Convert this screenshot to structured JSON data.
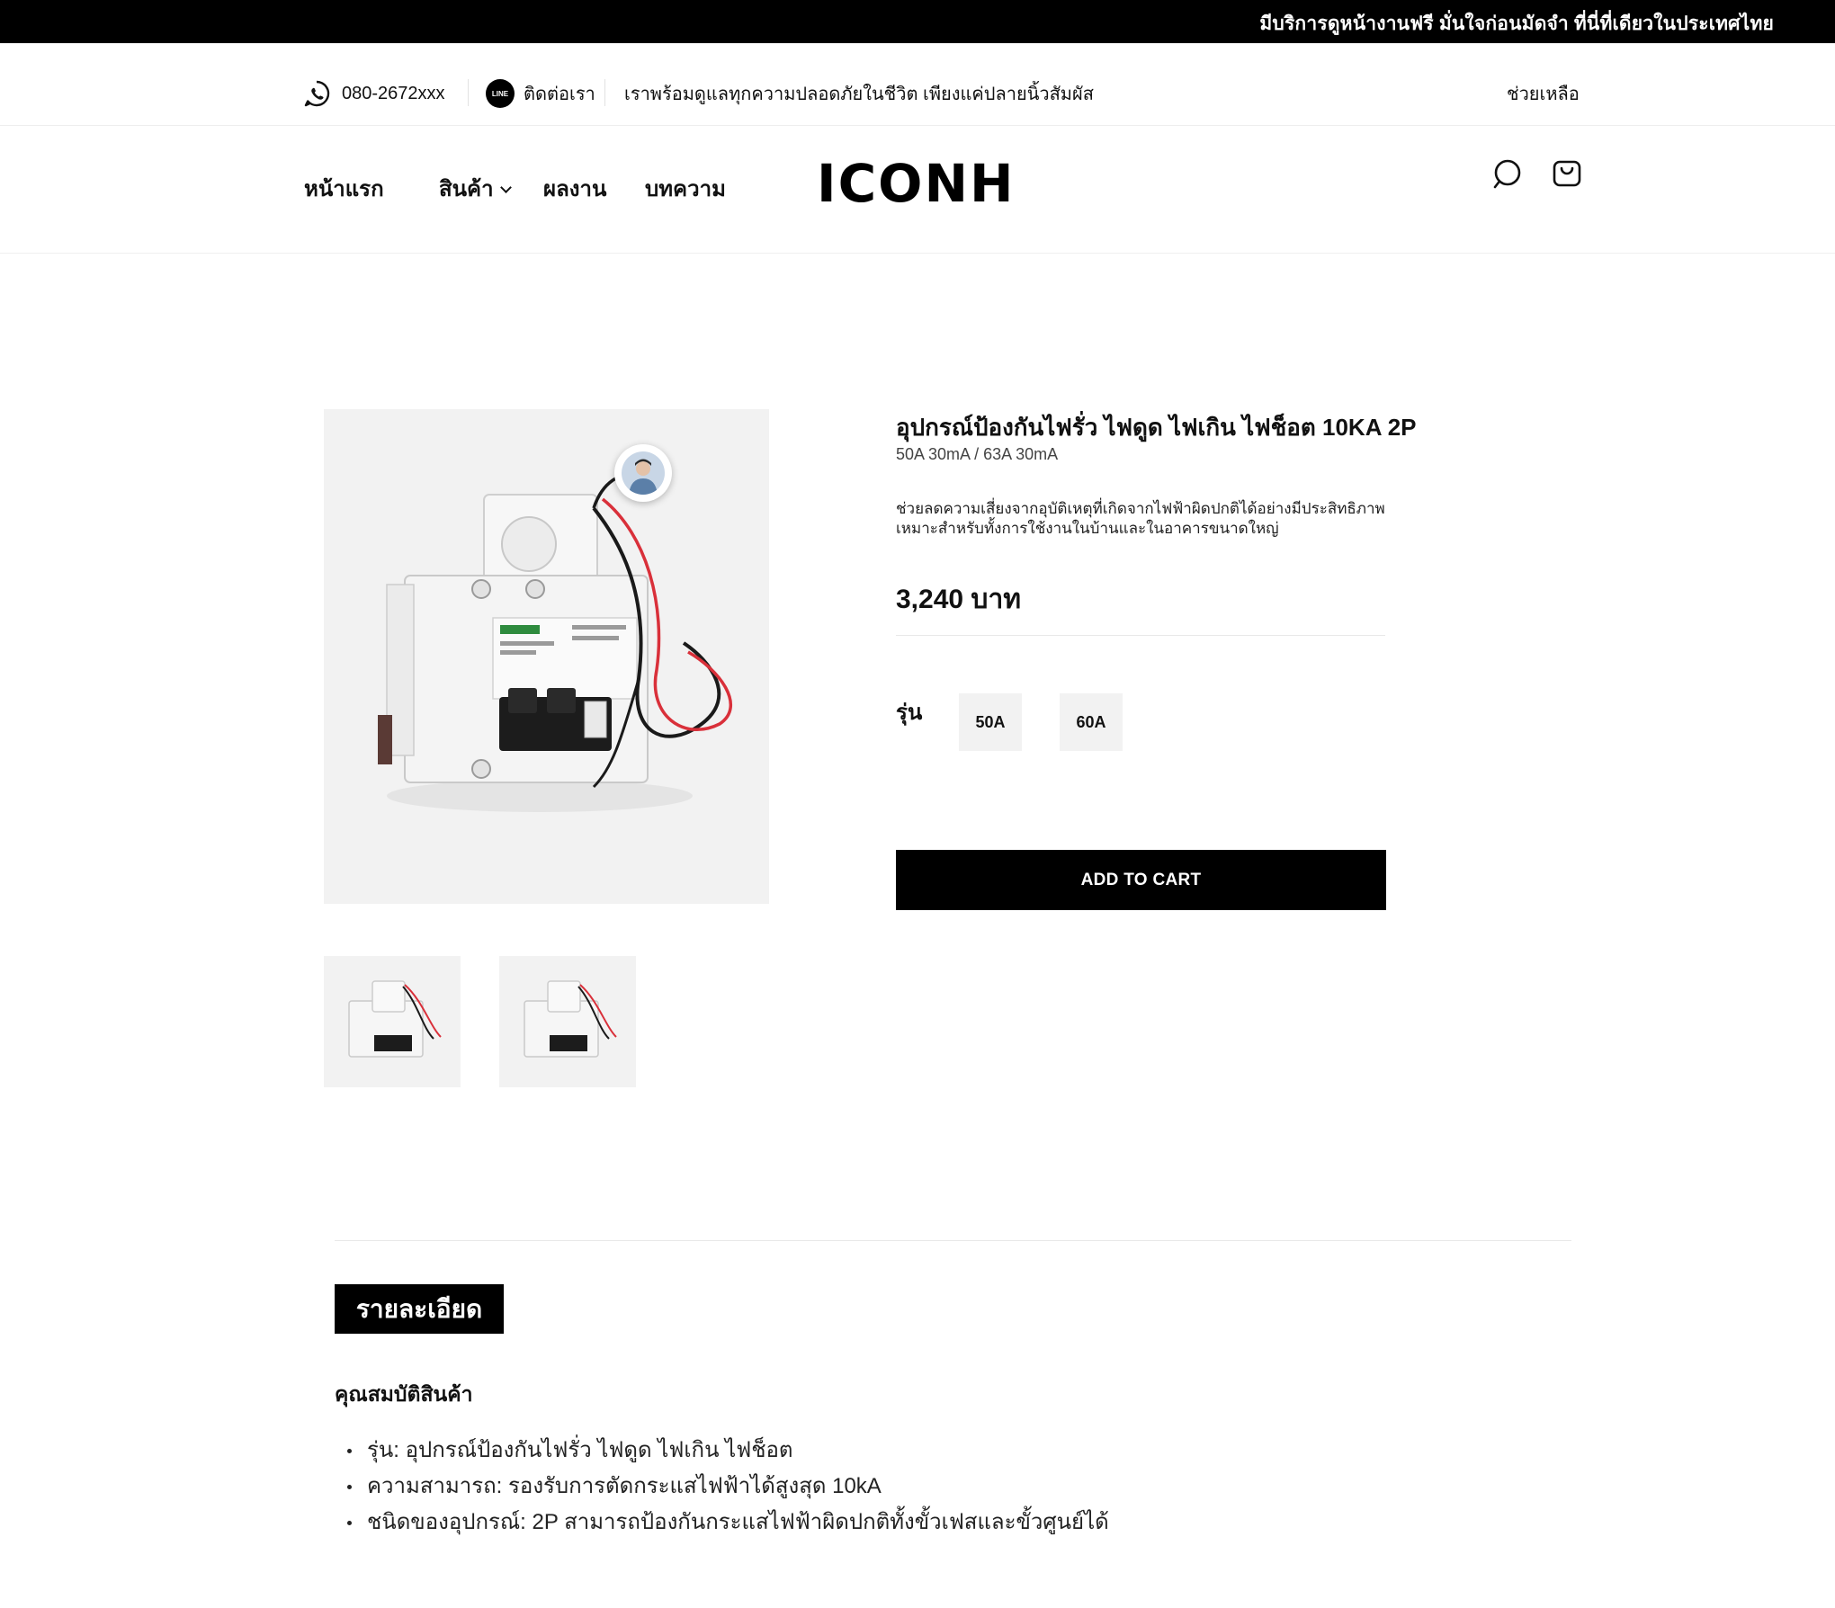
{
  "announcement": "มีบริการดูหน้างานฟรี มั่นใจก่อนมัดจำ ที่นี่ที่เดียวในประเทศไทย",
  "utility_bar": {
    "phone": "080-2672xxx",
    "line_badge": "LINE",
    "contact": "ติดต่อเรา",
    "tagline": "เราพร้อมดูแลทุกความปลอดภัยในชีวิต เพียงแค่ปลายนิ้วสัมผัส",
    "help": "ช่วยเหลือ"
  },
  "nav": {
    "home": "หน้าแรก",
    "products": "สินค้า",
    "portfolio": "ผลงาน",
    "articles": "บทความ"
  },
  "brand": {
    "logo_text": "ICONH"
  },
  "header_icons": {
    "search": "search-icon",
    "cart": "shopping-bag-icon"
  },
  "product": {
    "title": "อุปกรณ์ป้องกันไฟรั่ว ไฟดูด ไฟเกิน ไฟช็อต 10KA 2P",
    "subtitle": "50A 30mA / 63A 30mA",
    "description_line1": "ช่วยลดความเสี่ยงจากอุบัติเหตุที่เกิดจากไฟฟ้าผิดปกติได้อย่างมีประสิทธิภาพ",
    "description_line2": "เหมาะสำหรับทั้งการใช้งานในบ้านและในอาคารขนาดใหญ่",
    "price": "3,240 บาท",
    "variant_label": "รุ่น",
    "variants": [
      "50A",
      "60A"
    ],
    "add_to_cart": "ADD TO CART"
  },
  "details": {
    "tab": "รายละเอียด",
    "heading": "คุณสมบัติสินค้า",
    "specs": [
      "รุ่น: อุปกรณ์ป้องกันไฟรั่ว ไฟดูด ไฟเกิน ไฟช็อต",
      "ความสามารถ: รองรับการตัดกระแสไฟฟ้าได้สูงสุด 10kA",
      "ชนิดของอุปกรณ์: 2P สามารถป้องกันกระแสไฟฟ้าผิดปกติทั้งขั้วเฟสและขั้วศูนย์ได้"
    ]
  },
  "colors": {
    "topbar": "#000000",
    "button": "#000000",
    "panel": "#f2f2f2",
    "wire_red": "#d9303a"
  }
}
